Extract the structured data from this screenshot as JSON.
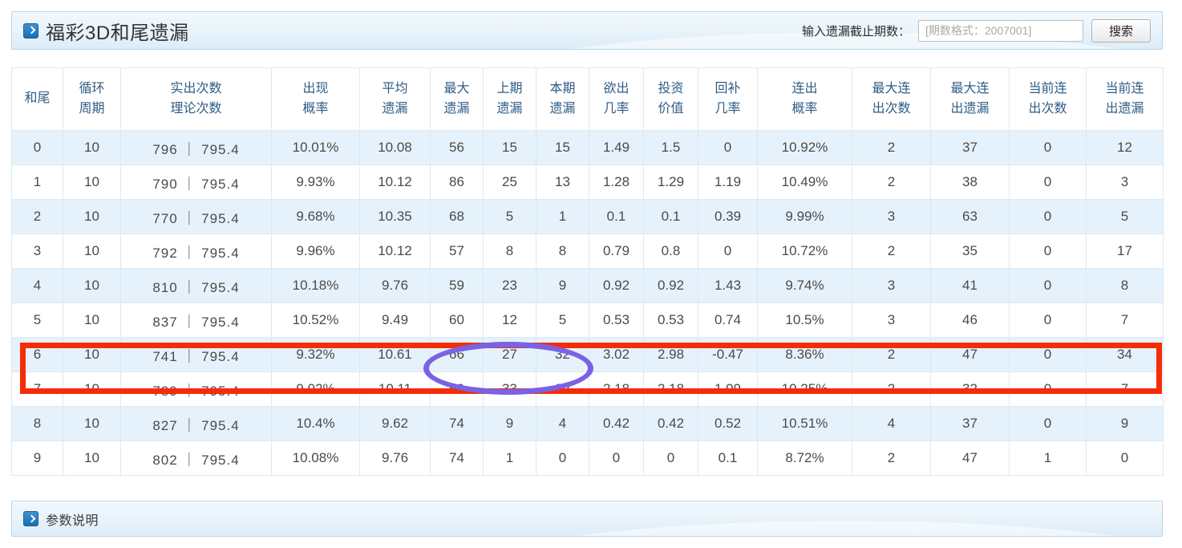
{
  "header": {
    "icon": "chevron-right-icon",
    "title": "福彩3D和尾遗漏",
    "search_label": "输入遗漏截止期数：",
    "search_placeholder": "[期数格式：2007001]",
    "search_value": "",
    "search_button": "搜索"
  },
  "footer": {
    "icon": "chevron-right-icon",
    "title": "参数说明"
  },
  "colors": {
    "accent_blue": "#2c6894",
    "row_alt_bg": "#e6f2fb",
    "annotation_red": "#f42d06",
    "annotation_purple": "#7b61e4",
    "header_text": "#2f5d85"
  },
  "table": {
    "columns": [
      {
        "line1": "和尾",
        "line2": ""
      },
      {
        "line1": "循环",
        "line2": "周期"
      },
      {
        "line1": "实出次数",
        "line2": "理论次数"
      },
      {
        "line1": "出现",
        "line2": "概率"
      },
      {
        "line1": "平均",
        "line2": "遗漏"
      },
      {
        "line1": "最大",
        "line2": "遗漏"
      },
      {
        "line1": "上期",
        "line2": "遗漏"
      },
      {
        "line1": "本期",
        "line2": "遗漏"
      },
      {
        "line1": "欲出",
        "line2": "几率"
      },
      {
        "line1": "投资",
        "line2": "价值"
      },
      {
        "line1": "回补",
        "line2": "几率"
      },
      {
        "line1": "连出",
        "line2": "概率"
      },
      {
        "line1": "最大连",
        "line2": "出次数"
      },
      {
        "line1": "最大连",
        "line2": "出遗漏"
      },
      {
        "line1": "当前连",
        "line2": "出次数"
      },
      {
        "line1": "当前连",
        "line2": "出遗漏"
      }
    ],
    "rows": [
      [
        "0",
        "10",
        "796 ｜ 795.4",
        "10.01%",
        "10.08",
        "56",
        "15",
        "15",
        "1.49",
        "1.5",
        "0",
        "10.92%",
        "2",
        "37",
        "0",
        "12"
      ],
      [
        "1",
        "10",
        "790 ｜ 795.4",
        "9.93%",
        "10.12",
        "86",
        "25",
        "13",
        "1.28",
        "1.29",
        "1.19",
        "10.49%",
        "2",
        "38",
        "0",
        "3"
      ],
      [
        "2",
        "10",
        "770 ｜ 795.4",
        "9.68%",
        "10.35",
        "68",
        "5",
        "1",
        "0.1",
        "0.1",
        "0.39",
        "9.99%",
        "3",
        "63",
        "0",
        "5"
      ],
      [
        "3",
        "10",
        "792 ｜ 795.4",
        "9.96%",
        "10.12",
        "57",
        "8",
        "8",
        "0.79",
        "0.8",
        "0",
        "10.72%",
        "2",
        "35",
        "0",
        "17"
      ],
      [
        "4",
        "10",
        "810 ｜ 795.4",
        "10.18%",
        "9.76",
        "59",
        "23",
        "9",
        "0.92",
        "0.92",
        "1.43",
        "9.74%",
        "3",
        "41",
        "0",
        "8"
      ],
      [
        "5",
        "10",
        "837 ｜ 795.4",
        "10.52%",
        "9.49",
        "60",
        "12",
        "5",
        "0.53",
        "0.53",
        "0.74",
        "10.5%",
        "3",
        "46",
        "0",
        "7"
      ],
      [
        "6",
        "10",
        "741 ｜ 795.4",
        "9.32%",
        "10.61",
        "66",
        "27",
        "32",
        "3.02",
        "2.98",
        "-0.47",
        "8.36%",
        "2",
        "47",
        "0",
        "34"
      ],
      [
        "7",
        "10",
        "789 ｜ 795.4",
        "9.92%",
        "10.11",
        "50",
        "33",
        "22",
        "2.18",
        "2.18",
        "1.09",
        "10.25%",
        "2",
        "32",
        "0",
        "7"
      ],
      [
        "8",
        "10",
        "827 ｜ 795.4",
        "10.4%",
        "9.62",
        "74",
        "9",
        "4",
        "0.42",
        "0.42",
        "0.52",
        "10.51%",
        "4",
        "37",
        "0",
        "9"
      ],
      [
        "9",
        "10",
        "802 ｜ 795.4",
        "10.08%",
        "9.76",
        "74",
        "1",
        "0",
        "0",
        "0",
        "0.1",
        "8.72%",
        "2",
        "47",
        "1",
        "0"
      ]
    ]
  },
  "annotations": {
    "highlight_row_index": 6,
    "highlight_rect_color": "#f42d06",
    "ellipse_color": "#7b61e4",
    "ellipse_covers_columns": [
      "最大遗漏",
      "上期遗漏",
      "本期遗漏"
    ],
    "ellipse_values": [
      "66",
      "27",
      "32"
    ]
  }
}
